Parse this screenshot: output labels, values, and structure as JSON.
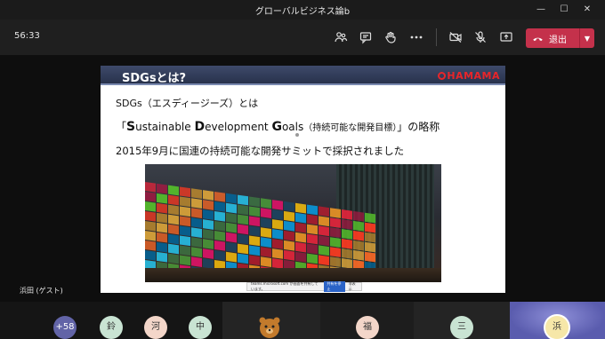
{
  "window": {
    "title": "グローバルビジネス論b",
    "minimize": "—",
    "maximize": "☐",
    "close": "✕"
  },
  "controls": {
    "timer": "56:33",
    "icons": [
      "people-icon",
      "chat-icon",
      "raise-hand-icon",
      "more-options-icon",
      "camera-off-icon",
      "mic-off-icon",
      "share-tray-icon"
    ],
    "leave_label": "退出",
    "leave_color": "#c4314b"
  },
  "slide": {
    "title": "SDGsとは?",
    "logo": "HAMAMA",
    "line1": "SDGs（エスディージーズ）とは",
    "line2_open": "「",
    "line2_s": "S",
    "line2_ustainable": "ustainable ",
    "line2_d": "D",
    "line2_evelopment": "evelopment ",
    "line2_g": "G",
    "line2_oals": "oals",
    "line2_paren": "（持続可能な開発目標）",
    "line2_close": "」の略称",
    "line3": "2015年9月に国連の持続可能な開発サミットで採択されました",
    "share_text": "teams.microsoft.com が画面を共有しています。",
    "share_stop": "共有を停止",
    "share_hide": "非表示"
  },
  "presenter": "浜田 (ゲスト)",
  "participants": [
    {
      "label": "+58",
      "bg": "#6264a7",
      "fg": "#ffffff"
    },
    {
      "label": "鈴",
      "bg": "#c9e4d3",
      "fg": "#333333"
    },
    {
      "label": "河",
      "bg": "#f3d6c9",
      "fg": "#333333"
    },
    {
      "label": "中",
      "bg": "#c9e4d3",
      "fg": "#333333"
    },
    {
      "label": "",
      "bg": "#c27a2c",
      "fg": "#333333"
    },
    {
      "label": "福",
      "bg": "#f3d6c9",
      "fg": "#333333"
    },
    {
      "label": "三",
      "bg": "#c9e4d3",
      "fg": "#333333"
    },
    {
      "label": "浜",
      "bg": "#f6e7a8",
      "fg": "#333333"
    }
  ]
}
